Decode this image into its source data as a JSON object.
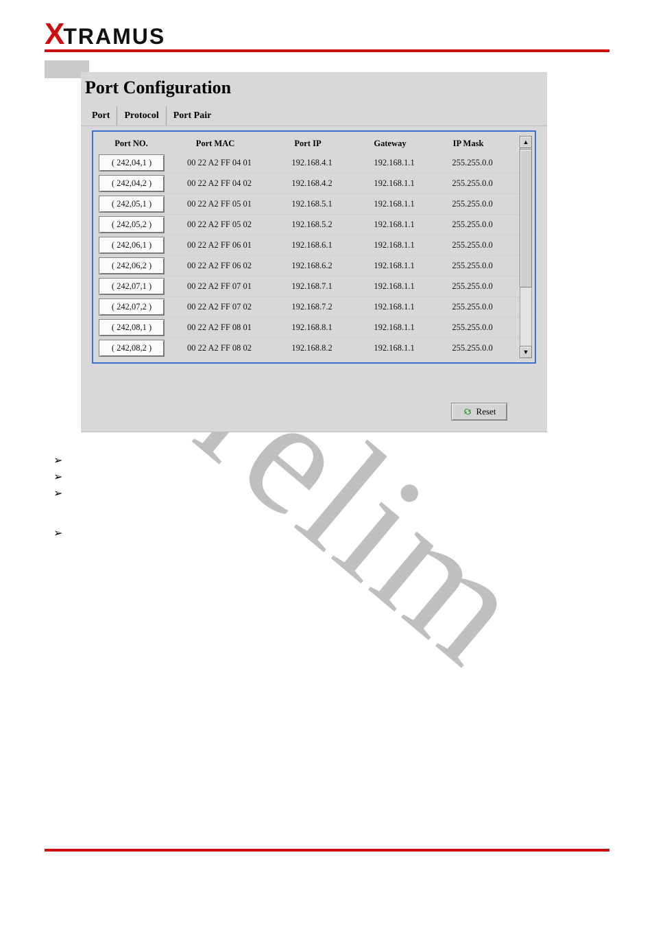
{
  "brand": {
    "x": "X",
    "rest": "TRAMUS"
  },
  "watermark": "Prelim",
  "panel": {
    "title": "Port Configuration",
    "tabs": [
      {
        "label": "Port"
      },
      {
        "label": "Protocol"
      },
      {
        "label": "Port Pair"
      }
    ],
    "headers": {
      "no": "Port NO.",
      "mac": "Port MAC",
      "ip": "Port IP",
      "gw": "Gateway",
      "mask": "IP Mask"
    },
    "rows": [
      {
        "no": "( 242,04,1 )",
        "mac": "00 22 A2 FF 04 01",
        "ip": "192.168.4.1",
        "gw": "192.168.1.1",
        "mask": "255.255.0.0"
      },
      {
        "no": "( 242,04,2 )",
        "mac": "00 22 A2 FF 04 02",
        "ip": "192.168.4.2",
        "gw": "192.168.1.1",
        "mask": "255.255.0.0"
      },
      {
        "no": "( 242,05,1 )",
        "mac": "00 22 A2 FF 05 01",
        "ip": "192.168.5.1",
        "gw": "192.168.1.1",
        "mask": "255.255.0.0"
      },
      {
        "no": "( 242,05,2 )",
        "mac": "00 22 A2 FF 05 02",
        "ip": "192.168.5.2",
        "gw": "192.168.1.1",
        "mask": "255.255.0.0"
      },
      {
        "no": "( 242,06,1 )",
        "mac": "00 22 A2 FF 06 01",
        "ip": "192.168.6.1",
        "gw": "192.168.1.1",
        "mask": "255.255.0.0"
      },
      {
        "no": "( 242,06,2 )",
        "mac": "00 22 A2 FF 06 02",
        "ip": "192.168.6.2",
        "gw": "192.168.1.1",
        "mask": "255.255.0.0"
      },
      {
        "no": "( 242,07,1 )",
        "mac": "00 22 A2 FF 07 01",
        "ip": "192.168.7.1",
        "gw": "192.168.1.1",
        "mask": "255.255.0.0"
      },
      {
        "no": "( 242,07,2 )",
        "mac": "00 22 A2 FF 07 02",
        "ip": "192.168.7.2",
        "gw": "192.168.1.1",
        "mask": "255.255.0.0"
      },
      {
        "no": "( 242,08,1 )",
        "mac": "00 22 A2 FF 08 01",
        "ip": "192.168.8.1",
        "gw": "192.168.1.1",
        "mask": "255.255.0.0"
      },
      {
        "no": "( 242,08,2 )",
        "mac": "00 22 A2 FF 08 02",
        "ip": "192.168.8.2",
        "gw": "192.168.1.1",
        "mask": "255.255.0.0"
      }
    ],
    "reset_label": "Reset"
  }
}
